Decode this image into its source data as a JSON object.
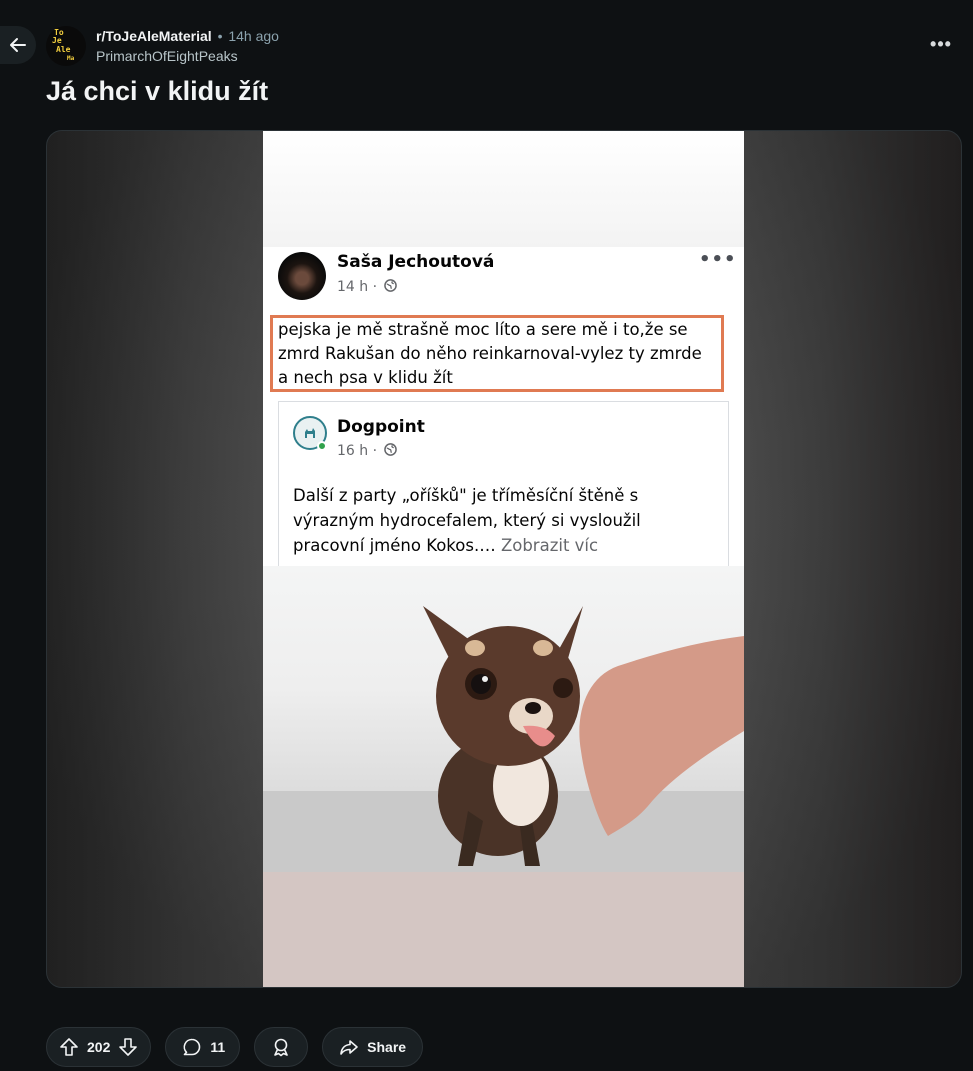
{
  "header": {
    "back_label": "Back",
    "subreddit": "r/ToJeAleMaterial",
    "separator": "•",
    "posted_ago": "14h ago",
    "author": "PrimarchOfEightPeaks",
    "avatar_text": [
      "To",
      "Je",
      "Ale",
      "Ma"
    ],
    "more_label": "•••"
  },
  "post": {
    "title": "Já chci v klidu žít"
  },
  "screenshot": {
    "poster_name": "Saša Jechoutová",
    "poster_time": "14 h ·",
    "menu": "•••",
    "comment_lines": [
      "pejska je mě strašně moc líto a sere mě i to,že se",
      "zmrd Rakušan do něho reinkarnoval-vylez ty zmrde",
      "a nech psa v klidu žít"
    ],
    "shared_page": {
      "name": "Dogpoint",
      "time": "16 h ·",
      "lines": [
        "Další z party „oříšků\" je tříměsíční štěně s",
        "výrazným hydrocefalem, který si vysloužil",
        "pracovní jméno Kokos.… "
      ],
      "more": "Zobrazit víc"
    }
  },
  "actions": {
    "upvotes": "202",
    "comments": "11",
    "share_label": "Share"
  },
  "colors": {
    "background": "#0e1113",
    "pill": "#1a2023",
    "highlight_border": "#e07a52",
    "text_primary": "#f2f4f5",
    "text_secondary": "#8ba2ad"
  },
  "icons": [
    "back-arrow-icon",
    "more-options-icon",
    "globe-icon",
    "upvote-icon",
    "downvote-icon",
    "comment-icon",
    "award-icon",
    "share-icon"
  ]
}
